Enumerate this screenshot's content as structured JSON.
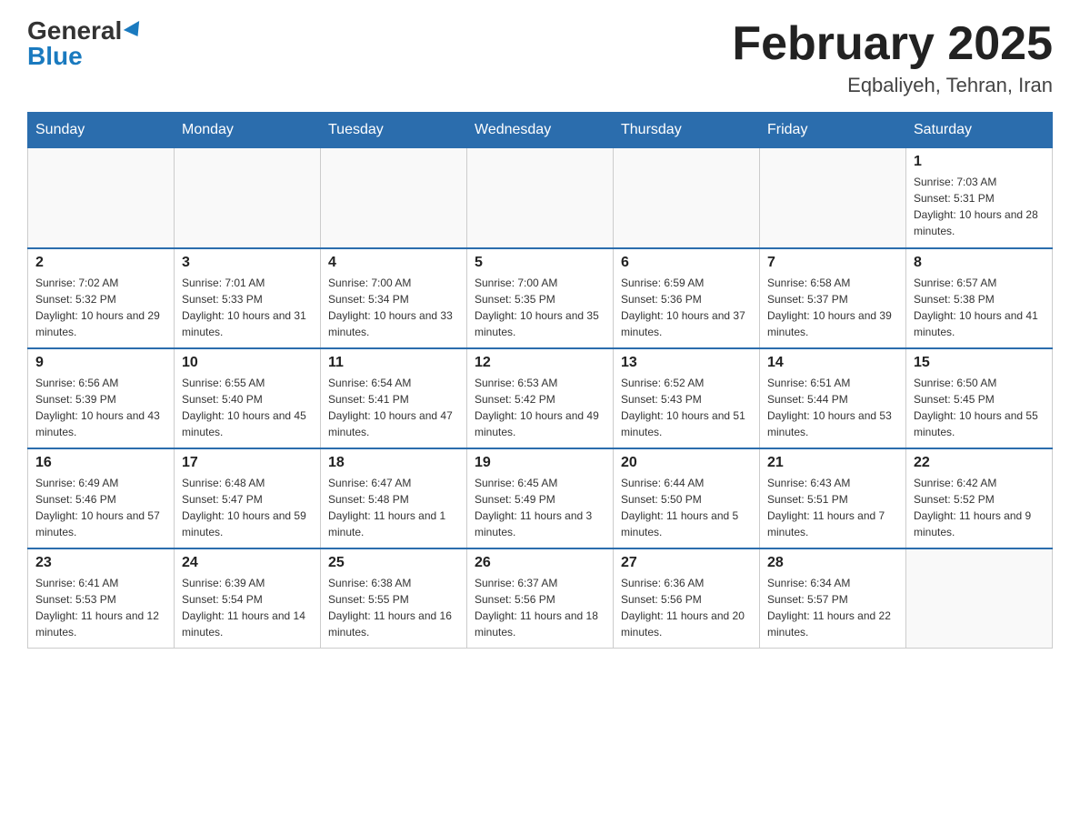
{
  "header": {
    "logo_general": "General",
    "logo_blue": "Blue",
    "month_title": "February 2025",
    "location": "Eqbaliyeh, Tehran, Iran"
  },
  "weekdays": [
    "Sunday",
    "Monday",
    "Tuesday",
    "Wednesday",
    "Thursday",
    "Friday",
    "Saturday"
  ],
  "weeks": [
    [
      {
        "day": "",
        "info": ""
      },
      {
        "day": "",
        "info": ""
      },
      {
        "day": "",
        "info": ""
      },
      {
        "day": "",
        "info": ""
      },
      {
        "day": "",
        "info": ""
      },
      {
        "day": "",
        "info": ""
      },
      {
        "day": "1",
        "info": "Sunrise: 7:03 AM\nSunset: 5:31 PM\nDaylight: 10 hours and 28 minutes."
      }
    ],
    [
      {
        "day": "2",
        "info": "Sunrise: 7:02 AM\nSunset: 5:32 PM\nDaylight: 10 hours and 29 minutes."
      },
      {
        "day": "3",
        "info": "Sunrise: 7:01 AM\nSunset: 5:33 PM\nDaylight: 10 hours and 31 minutes."
      },
      {
        "day": "4",
        "info": "Sunrise: 7:00 AM\nSunset: 5:34 PM\nDaylight: 10 hours and 33 minutes."
      },
      {
        "day": "5",
        "info": "Sunrise: 7:00 AM\nSunset: 5:35 PM\nDaylight: 10 hours and 35 minutes."
      },
      {
        "day": "6",
        "info": "Sunrise: 6:59 AM\nSunset: 5:36 PM\nDaylight: 10 hours and 37 minutes."
      },
      {
        "day": "7",
        "info": "Sunrise: 6:58 AM\nSunset: 5:37 PM\nDaylight: 10 hours and 39 minutes."
      },
      {
        "day": "8",
        "info": "Sunrise: 6:57 AM\nSunset: 5:38 PM\nDaylight: 10 hours and 41 minutes."
      }
    ],
    [
      {
        "day": "9",
        "info": "Sunrise: 6:56 AM\nSunset: 5:39 PM\nDaylight: 10 hours and 43 minutes."
      },
      {
        "day": "10",
        "info": "Sunrise: 6:55 AM\nSunset: 5:40 PM\nDaylight: 10 hours and 45 minutes."
      },
      {
        "day": "11",
        "info": "Sunrise: 6:54 AM\nSunset: 5:41 PM\nDaylight: 10 hours and 47 minutes."
      },
      {
        "day": "12",
        "info": "Sunrise: 6:53 AM\nSunset: 5:42 PM\nDaylight: 10 hours and 49 minutes."
      },
      {
        "day": "13",
        "info": "Sunrise: 6:52 AM\nSunset: 5:43 PM\nDaylight: 10 hours and 51 minutes."
      },
      {
        "day": "14",
        "info": "Sunrise: 6:51 AM\nSunset: 5:44 PM\nDaylight: 10 hours and 53 minutes."
      },
      {
        "day": "15",
        "info": "Sunrise: 6:50 AM\nSunset: 5:45 PM\nDaylight: 10 hours and 55 minutes."
      }
    ],
    [
      {
        "day": "16",
        "info": "Sunrise: 6:49 AM\nSunset: 5:46 PM\nDaylight: 10 hours and 57 minutes."
      },
      {
        "day": "17",
        "info": "Sunrise: 6:48 AM\nSunset: 5:47 PM\nDaylight: 10 hours and 59 minutes."
      },
      {
        "day": "18",
        "info": "Sunrise: 6:47 AM\nSunset: 5:48 PM\nDaylight: 11 hours and 1 minute."
      },
      {
        "day": "19",
        "info": "Sunrise: 6:45 AM\nSunset: 5:49 PM\nDaylight: 11 hours and 3 minutes."
      },
      {
        "day": "20",
        "info": "Sunrise: 6:44 AM\nSunset: 5:50 PM\nDaylight: 11 hours and 5 minutes."
      },
      {
        "day": "21",
        "info": "Sunrise: 6:43 AM\nSunset: 5:51 PM\nDaylight: 11 hours and 7 minutes."
      },
      {
        "day": "22",
        "info": "Sunrise: 6:42 AM\nSunset: 5:52 PM\nDaylight: 11 hours and 9 minutes."
      }
    ],
    [
      {
        "day": "23",
        "info": "Sunrise: 6:41 AM\nSunset: 5:53 PM\nDaylight: 11 hours and 12 minutes."
      },
      {
        "day": "24",
        "info": "Sunrise: 6:39 AM\nSunset: 5:54 PM\nDaylight: 11 hours and 14 minutes."
      },
      {
        "day": "25",
        "info": "Sunrise: 6:38 AM\nSunset: 5:55 PM\nDaylight: 11 hours and 16 minutes."
      },
      {
        "day": "26",
        "info": "Sunrise: 6:37 AM\nSunset: 5:56 PM\nDaylight: 11 hours and 18 minutes."
      },
      {
        "day": "27",
        "info": "Sunrise: 6:36 AM\nSunset: 5:56 PM\nDaylight: 11 hours and 20 minutes."
      },
      {
        "day": "28",
        "info": "Sunrise: 6:34 AM\nSunset: 5:57 PM\nDaylight: 11 hours and 22 minutes."
      },
      {
        "day": "",
        "info": ""
      }
    ]
  ]
}
